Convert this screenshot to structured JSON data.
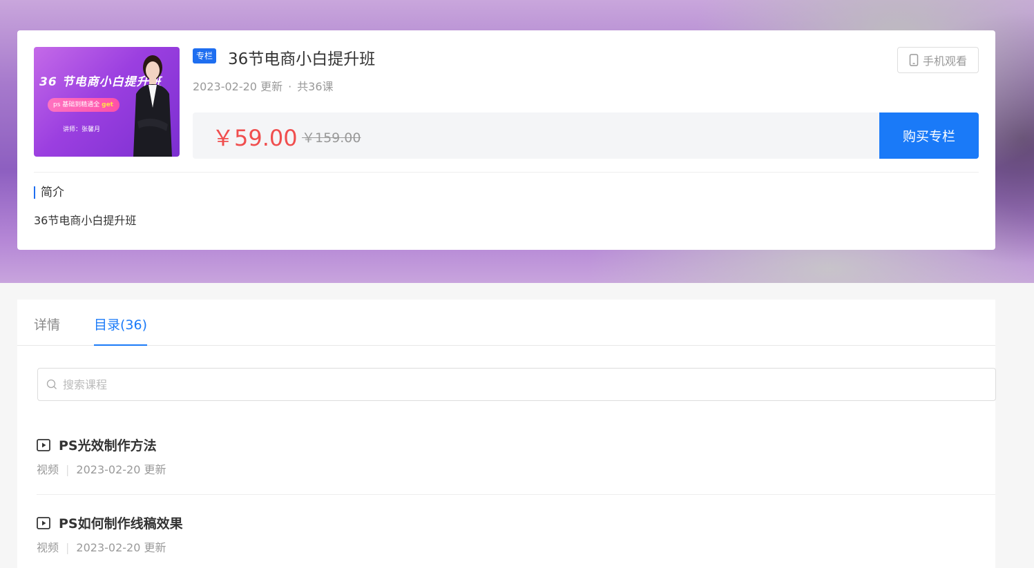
{
  "header": {
    "badge": "专栏",
    "title": "36节电商小白提升班",
    "updated": "2023-02-20 更新",
    "dot": "·",
    "lessons_count": "共36课",
    "mobile_button": "手机观看",
    "price": "￥59.00",
    "original_price": "￥159.00",
    "buy_button": "购买专栏",
    "cover": {
      "title": "36 节电商小白提升班",
      "pill_text": "ps 基础到精通全",
      "pill_highlight": "get",
      "teacher": "讲师：张馨月"
    }
  },
  "intro": {
    "heading": "简介",
    "text": "36节电商小白提升班"
  },
  "tabs": [
    {
      "label": "详情",
      "active": false
    },
    {
      "label": "目录(36)",
      "active": true
    }
  ],
  "search": {
    "placeholder": "搜索课程"
  },
  "lessons": [
    {
      "title": "PS光效制作方法",
      "type": "视频",
      "separator": "|",
      "updated": "2023-02-20 更新"
    },
    {
      "title": "PS如何制作线稿效果",
      "type": "视频",
      "separator": "|",
      "updated": "2023-02-20 更新"
    }
  ],
  "colors": {
    "accent": "#1a7af8",
    "price": "#f04e4e",
    "badge": "#1e6ef0"
  }
}
